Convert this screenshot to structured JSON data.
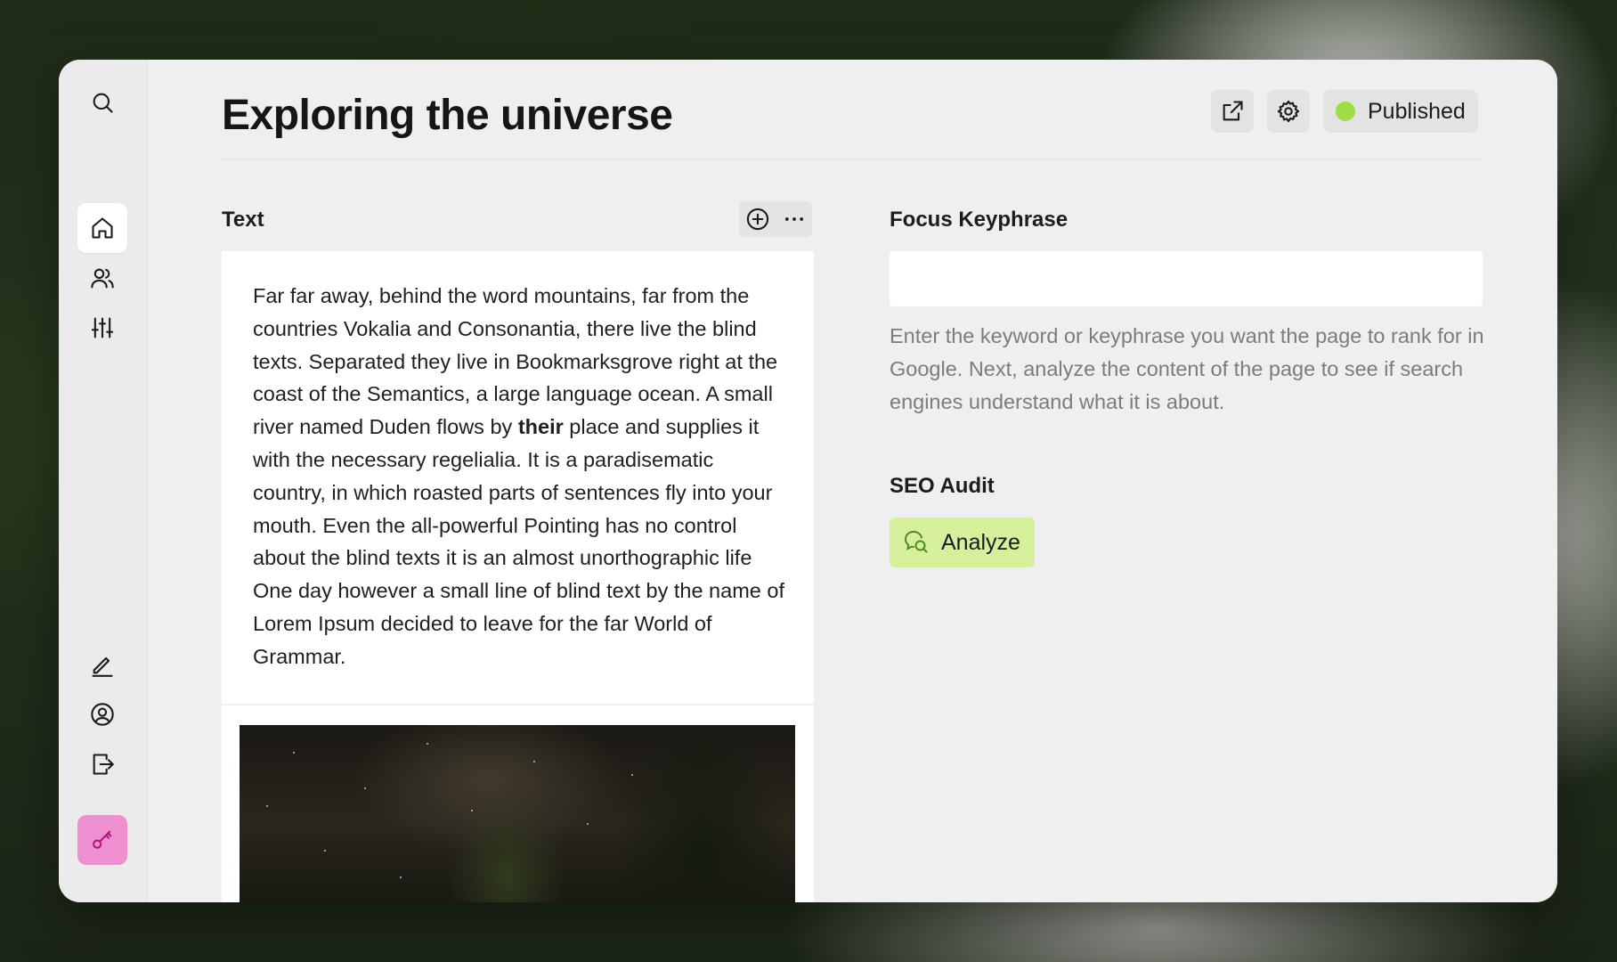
{
  "header": {
    "title": "Exploring the universe",
    "status_label": "Published",
    "status_color": "#9fdc45"
  },
  "sidebar": {
    "top": [
      "search-icon"
    ],
    "nav": [
      "home-icon",
      "users-icon",
      "sliders-icon"
    ],
    "bottom": [
      "pencil-icon",
      "user-circle-icon",
      "logout-icon",
      "key-icon"
    ],
    "active": "home-icon",
    "key_button_color": "#f08fd0"
  },
  "text_section": {
    "label": "Text",
    "body_before_bold": "Far far away, behind the word mountains, far from the countries Vokalia and Consonantia, there live the blind texts. Separated they live in Bookmarksgrove right at the coast of the Semantics, a large language ocean. A small river named Duden flows by ",
    "body_bold": "their",
    "body_after_bold": " place and supplies it with the necessary regelialia. It is a paradisematic country, in which roasted parts of sentences fly into your mouth. Even the all-powerful Pointing has no control about the blind texts it is an almost unorthographic life One day however a small line of blind text by the name of Lorem Ipsum decided to leave for the far World of Grammar."
  },
  "focus_keyphrase": {
    "label": "Focus Keyphrase",
    "value": "",
    "help": "Enter the keyword or keyphrase you want the page to rank for in Google. Next, analyze the content of the page to see if search engines understand what it is about."
  },
  "seo_audit": {
    "label": "SEO Audit",
    "button_label": "Analyze",
    "button_color": "#d5ef9c"
  }
}
